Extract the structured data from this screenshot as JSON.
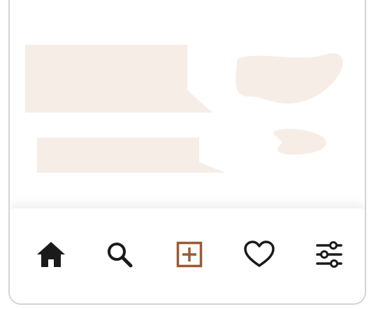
{
  "colors": {
    "placeholder_fill": "#f6ede6",
    "icon_default": "#1a1a1a",
    "icon_active": "#9a5b32",
    "border": "#d4d4d4"
  },
  "nav": {
    "items": [
      {
        "icon": "home-icon",
        "active": false
      },
      {
        "icon": "search-icon",
        "active": false
      },
      {
        "icon": "add-post-icon",
        "active": true
      },
      {
        "icon": "heart-icon",
        "active": false
      },
      {
        "icon": "sliders-icon",
        "active": false
      }
    ]
  }
}
